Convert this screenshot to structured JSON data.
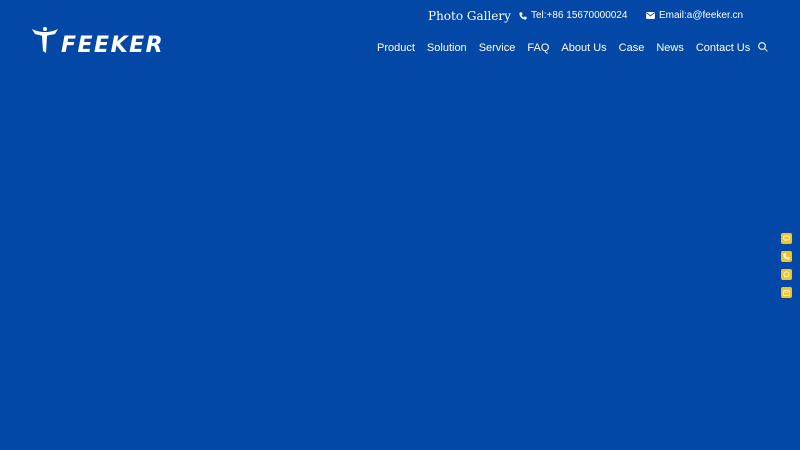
{
  "brand": {
    "name": "FEEKER",
    "background_color": "#0348a6",
    "accent_color": "#f6c325"
  },
  "topbar": {
    "gallery_label": "Photo Gallery",
    "tel_label": "Tel:+86 15670000024",
    "email_label": "Email:a@feeker.cn",
    "tel_icon": "phone-icon",
    "email_icon": "mail-icon"
  },
  "nav": {
    "items": [
      {
        "label": "Product"
      },
      {
        "label": "Solution"
      },
      {
        "label": "Service"
      },
      {
        "label": "FAQ"
      },
      {
        "label": "About Us"
      },
      {
        "label": "Case"
      },
      {
        "label": "News"
      },
      {
        "label": "Contact Us"
      }
    ],
    "search_icon": "search-icon"
  },
  "side_toolbar": {
    "items": [
      {
        "icon": "message-icon"
      },
      {
        "icon": "phone-icon"
      },
      {
        "icon": "chat-icon"
      },
      {
        "icon": "mail-icon"
      }
    ]
  }
}
